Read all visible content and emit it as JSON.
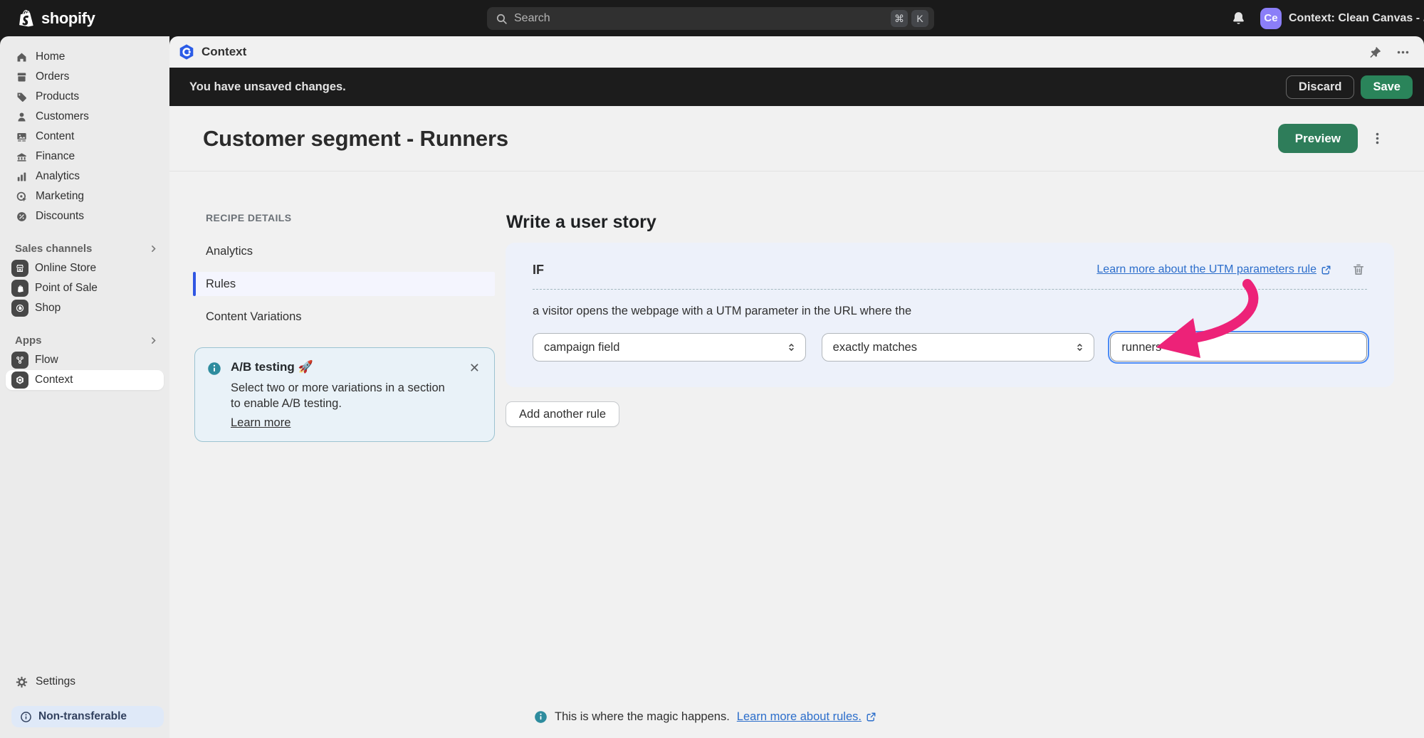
{
  "colors": {
    "topbar_bg": "#1a1a1a",
    "accent_green": "#2a845a",
    "link_blue": "#2c6ecb",
    "indigo_accent": "#3056e3",
    "info_teal": "#2e8c9e",
    "arrow_pink": "#ed2278",
    "avatar_purple": "#8b7ef8"
  },
  "topbar": {
    "logo": "shopify",
    "search": {
      "placeholder": "Search",
      "key_cmd": "⌘",
      "key_k": "K"
    },
    "store": {
      "initials": "Ce",
      "name": "Context: Clean Canvas - ..."
    }
  },
  "sidebar": {
    "items": [
      {
        "label": "Home"
      },
      {
        "label": "Orders"
      },
      {
        "label": "Products"
      },
      {
        "label": "Customers"
      },
      {
        "label": "Content"
      },
      {
        "label": "Finance"
      },
      {
        "label": "Analytics"
      },
      {
        "label": "Marketing"
      },
      {
        "label": "Discounts"
      }
    ],
    "sales_channels": {
      "label": "Sales channels",
      "items": [
        {
          "label": "Online Store"
        },
        {
          "label": "Point of Sale"
        },
        {
          "label": "Shop"
        }
      ]
    },
    "apps": {
      "label": "Apps",
      "items": [
        {
          "label": "Flow"
        },
        {
          "label": "Context"
        }
      ]
    },
    "settings": "Settings",
    "status_badge": "Non-transferable"
  },
  "app_header": {
    "title": "Context"
  },
  "save_bar": {
    "message": "You have unsaved changes.",
    "discard": "Discard",
    "save": "Save"
  },
  "page": {
    "title": "Customer segment - Runners",
    "preview": "Preview"
  },
  "recipe_nav": {
    "header": "RECIPE DETAILS",
    "items": [
      {
        "label": "Analytics"
      },
      {
        "label": "Rules"
      },
      {
        "label": "Content Variations"
      }
    ]
  },
  "ab_banner": {
    "title": "A/B testing 🚀",
    "body": "Select two or more variations in a section to enable A/B testing.",
    "link": "Learn more",
    "close": "✕"
  },
  "story": {
    "heading": "Write a user story",
    "if_label": "IF",
    "learn_link": "Learn more about the UTM parameters rule",
    "description": "a visitor opens the webpage with a UTM parameter in the URL where the",
    "field_value": "campaign field",
    "operator_value": "exactly matches",
    "utm_value": "runners",
    "add_rule": "Add another rule"
  },
  "footer_note": {
    "text": "This is where the magic happens.",
    "link": "Learn more about rules."
  }
}
